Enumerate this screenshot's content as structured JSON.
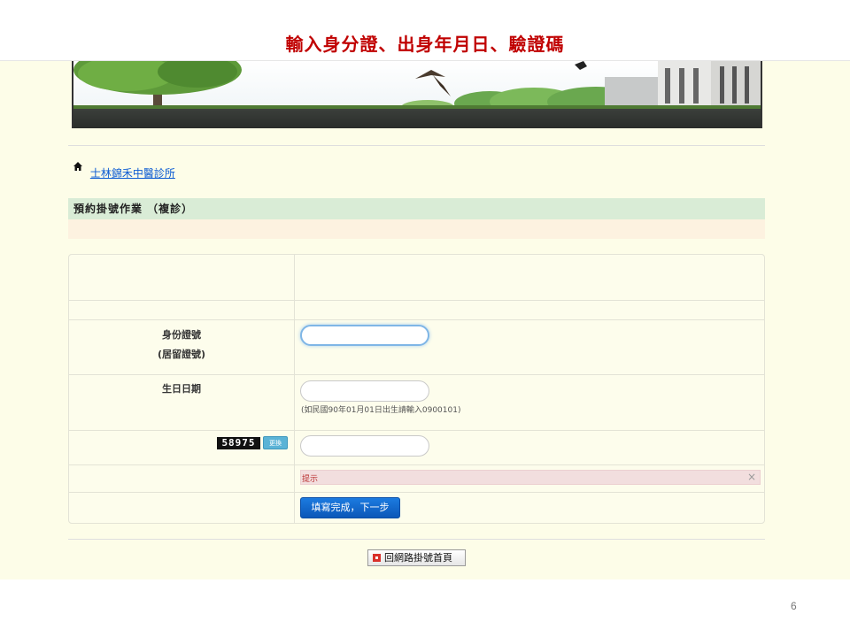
{
  "slide": {
    "title": "輸入身分證、出身年月日、驗證碼",
    "page_number": "6"
  },
  "breadcrumb": {
    "home_icon": "home-icon",
    "clinic_name": "士林錦禾中醫診所"
  },
  "section": {
    "title": "預約掛號作業 （複診）"
  },
  "form": {
    "id_label_line1": "身份證號",
    "id_label_line2": "(居留證號)",
    "id_value": "",
    "birthday_label": "生日日期",
    "birthday_value": "",
    "birthday_hint": "(如民國90年01月01日出生請輸入0900101)",
    "captcha_code": "58975",
    "captcha_refresh_label": "更換",
    "captcha_value": "",
    "alert_text": "提示",
    "alert_close_icon": "close-icon",
    "submit_label": "填寫完成，下一步"
  },
  "footer": {
    "home_button_label": "回網路掛號首頁"
  },
  "colors": {
    "title_red": "#c00000",
    "page_bg": "#fdfde8",
    "section_green": "#d9ecd6",
    "alert_pink": "#f2dede",
    "submit_blue": "#1c7be0",
    "link_blue": "#0b5bd3"
  }
}
